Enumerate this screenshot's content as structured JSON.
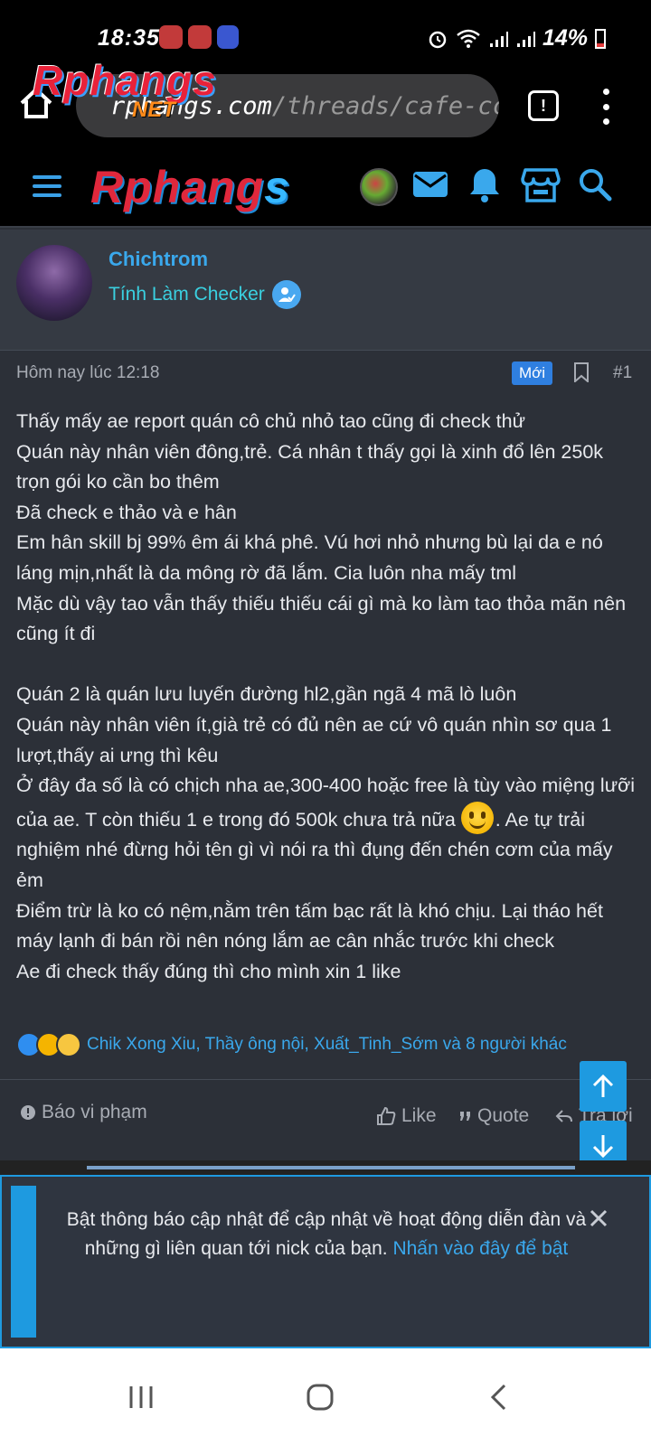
{
  "status_bar": {
    "time": "18:35",
    "battery": "14%"
  },
  "browser": {
    "url_domain": "rphangs.com",
    "url_path": "/threads/cafe-cc",
    "overlay_logo": "Rphangs",
    "overlay_net": "NET",
    "tab_count": "!"
  },
  "site_header": {
    "logo_text": "Rphang",
    "logo_tail": "s"
  },
  "post": {
    "author_name": "Chichtrom",
    "author_title": "Tính Làm Checker",
    "timestamp": "Hôm nay lúc 12:18",
    "new_badge": "Mới",
    "post_number": "#1",
    "body": {
      "l1": "Thấy mấy ae report quán cô chủ nhỏ tao cũng đi check thử",
      "l2": "Quán này nhân viên đông,trẻ. Cá nhân t thấy gọi là xinh đổ lên 250k trọn gói ko cần bo thêm",
      "l3": "Đã check e thảo và e hân",
      "l4": "Em hân skill bj 99% êm ái khá phê. Vú hơi nhỏ nhưng bù lại da e nó láng mịn,nhất là da mông rờ đã lắm. Cia luôn nha mấy tml",
      "l5": "Mặc dù vậy tao vẫn thấy thiếu thiếu cái gì mà ko làm tao thỏa mãn nên cũng ít đi",
      "l6": "Quán 2 là quán lưu luyến đường hl2,gần ngã 4 mã lò luôn",
      "l7": "Quán này nhân viên ít,già trẻ có đủ nên ae cứ vô quán nhìn sơ qua 1 lượt,thấy ai ưng thì kêu",
      "l8a": "Ở đây đa số là có chịch nha ae,300-400 hoặc free là tùy vào miệng lưỡi của ae. T còn thiếu 1 e trong đó 500k chưa trả nữa",
      "l8b": ". Ae tự trải nghiệm nhé đừng hỏi tên gì vì nói ra thì đụng đến chén cơm của mấy ẻm",
      "l9": "Điểm trừ là ko có nệm,nằm trên tấm bạc rất là khó chịu. Lại tháo hết máy lạnh đi bán rồi nên nóng lắm ae cân nhắc trước khi check",
      "l10": "Ae đi check thấy đúng thì cho mình xin 1 like"
    },
    "reactions_text": "Chik Xong Xiu, Thầy ông nội, Xuất_Tinh_Sớm và 8 người khác",
    "actions": {
      "report": "Báo vi phạm",
      "like": "Like",
      "quote": "Quote",
      "reply": "Trả lời"
    }
  },
  "notice": {
    "text": "Bật thông báo cập nhật để cập nhật về hoạt động diễn đàn và những gì liên quan tới nick của bạn.",
    "link": "Nhấn vào đây để bật"
  },
  "colors": {
    "accent": "#1e9ae0",
    "background": "#2c3038",
    "link": "#3aa8ec"
  }
}
